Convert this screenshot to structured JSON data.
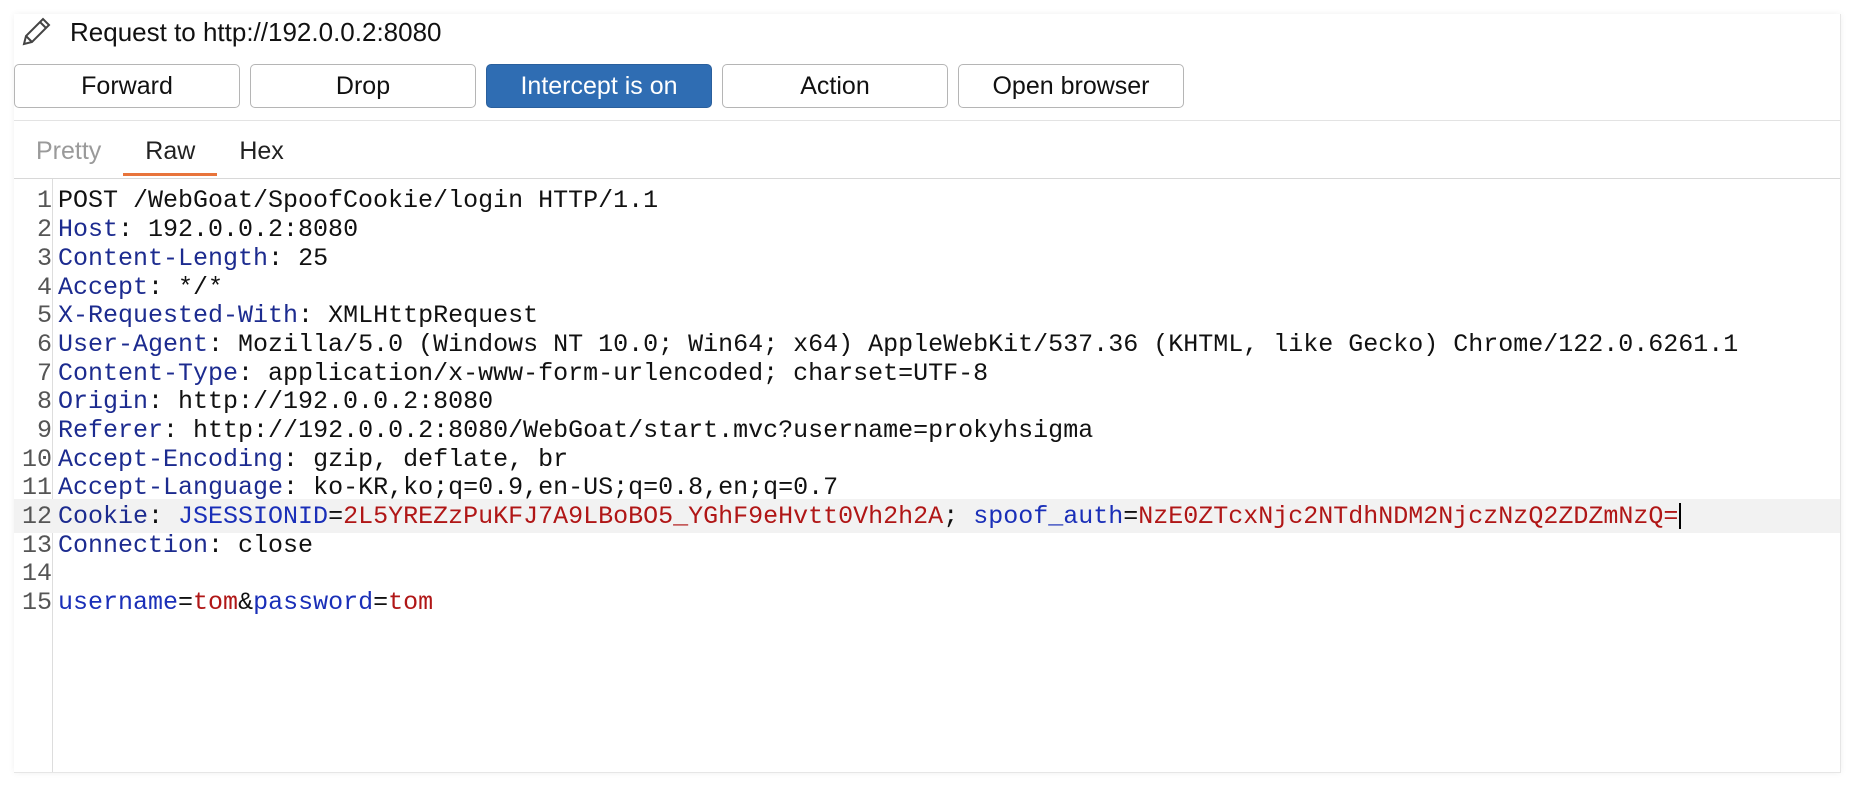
{
  "title": "Request to http://192.0.0.2:8080",
  "toolbar": {
    "forward": "Forward",
    "drop": "Drop",
    "intercept": "Intercept is on",
    "action": "Action",
    "open_browser": "Open browser"
  },
  "tabs": [
    "Pretty",
    "Raw",
    "Hex"
  ],
  "request": {
    "line1": "POST /WebGoat/SpoofCookie/login HTTP/1.1",
    "headers": [
      {
        "name": "Host",
        "value": "192.0.0.2:8080"
      },
      {
        "name": "Content-Length",
        "value": "25"
      },
      {
        "name": "Accept",
        "value": "*/*"
      },
      {
        "name": "X-Requested-With",
        "value": "XMLHttpRequest"
      },
      {
        "name": "User-Agent",
        "value": "Mozilla/5.0 (Windows NT 10.0; Win64; x64) AppleWebKit/537.36 (KHTML, like Gecko) Chrome/122.0.6261.1"
      },
      {
        "name": "Content-Type",
        "value": "application/x-www-form-urlencoded; charset=UTF-8"
      },
      {
        "name": "Origin",
        "value": "http://192.0.0.2:8080"
      },
      {
        "name": "Referer",
        "value": "http://192.0.0.2:8080/WebGoat/start.mvc?username=prokyhsigma"
      },
      {
        "name": "Accept-Encoding",
        "value": "gzip, deflate, br"
      },
      {
        "name": "Accept-Language",
        "value": "ko-KR,ko;q=0.9,en-US;q=0.8,en;q=0.7"
      }
    ],
    "cookie": {
      "name": "Cookie",
      "jsession_key": "JSESSIONID",
      "jsession_value": "2L5YREZzPuKFJ7A9LBoBO5_YGhF9eHvtt0Vh2h2A",
      "spoof_key": "spoof_auth",
      "spoof_value": "NzE0ZTcxNjc2NTdhNDM2NjczNzQ2ZDZmNzQ="
    },
    "connection": {
      "name": "Connection",
      "value": "close"
    },
    "body": {
      "user_key": "username",
      "user_value": "tom",
      "pass_key": "password",
      "pass_value": "tom"
    }
  },
  "line_numbers": [
    "1",
    "2",
    "3",
    "4",
    "5",
    "6",
    "7",
    "8",
    "9",
    "10",
    "11",
    "12",
    "13",
    "14",
    "15"
  ]
}
